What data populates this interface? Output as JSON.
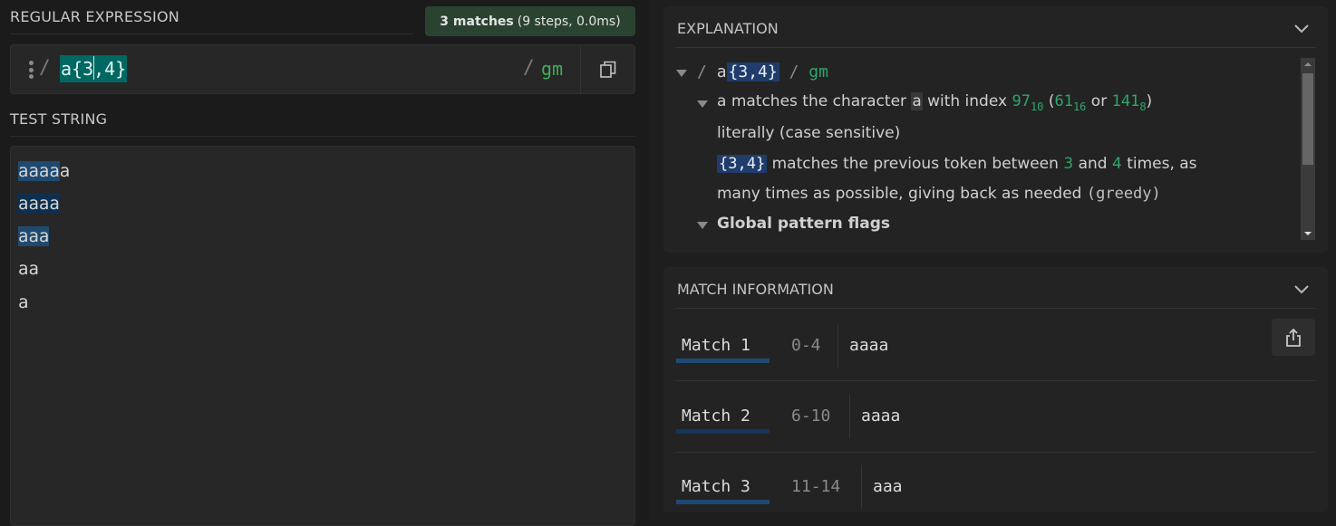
{
  "regex": {
    "section_title": "REGULAR EXPRESSION",
    "match_summary_bold": "3 matches",
    "match_summary_detail": "(9 steps, 0.0ms)",
    "open_delimiter": "/",
    "pattern_before_caret": "a{3",
    "pattern_after_caret": ",4}",
    "close_delimiter": "/",
    "flags": "gm",
    "copy_icon": "copy-icon",
    "drag_icon": "vertical-dots-icon"
  },
  "test_string": {
    "section_title": "TEST STRING",
    "lines": [
      {
        "matched": "aaaa",
        "rest": "a"
      },
      {
        "matched": "aaaa",
        "rest": ""
      },
      {
        "matched": "aaa",
        "rest": ""
      },
      {
        "matched": "",
        "rest": "aa"
      },
      {
        "matched": "",
        "rest": "a"
      }
    ]
  },
  "explanation": {
    "title": "EXPLANATION",
    "collapse_icon": "chevron-down-icon",
    "root": {
      "open": "/",
      "literal": "a",
      "quantifier": "{3,4}",
      "close": "/",
      "flags": "gm"
    },
    "token_a": {
      "lead": "a matches the character",
      "char": "a",
      "with_index": "with index",
      "dec": "97",
      "dec_base": "10",
      "paren_open": "(",
      "hex": "61",
      "hex_base": "16",
      "or": "or",
      "oct": "141",
      "oct_base": "8",
      "paren_close": ")",
      "line2": "literally (case sensitive)"
    },
    "token_quant": {
      "quantifier": "{3,4}",
      "text1": "matches the previous token between",
      "min": "3",
      "and": "and",
      "max": "4",
      "text2": "times, as",
      "line2": "many times as possible, giving back as needed",
      "mode": "(greedy)"
    },
    "flags_heading": "Global pattern flags"
  },
  "match_info": {
    "title": "MATCH INFORMATION",
    "collapse_icon": "chevron-down-icon",
    "share_icon": "share-icon",
    "matches": [
      {
        "label": "Match 1",
        "range": "0-4",
        "value": "aaaa"
      },
      {
        "label": "Match 2",
        "range": "6-10",
        "value": "aaaa"
      },
      {
        "label": "Match 3",
        "range": "11-14",
        "value": "aaa"
      }
    ]
  },
  "colors": {
    "match_highlight": "#1f4a70",
    "match_highlight_alt": "#0d3050",
    "regex_selection": "#006862",
    "flags_green": "#3fae59",
    "badge_bg": "#2a4331",
    "quantifier_bg": "#203c6a"
  }
}
